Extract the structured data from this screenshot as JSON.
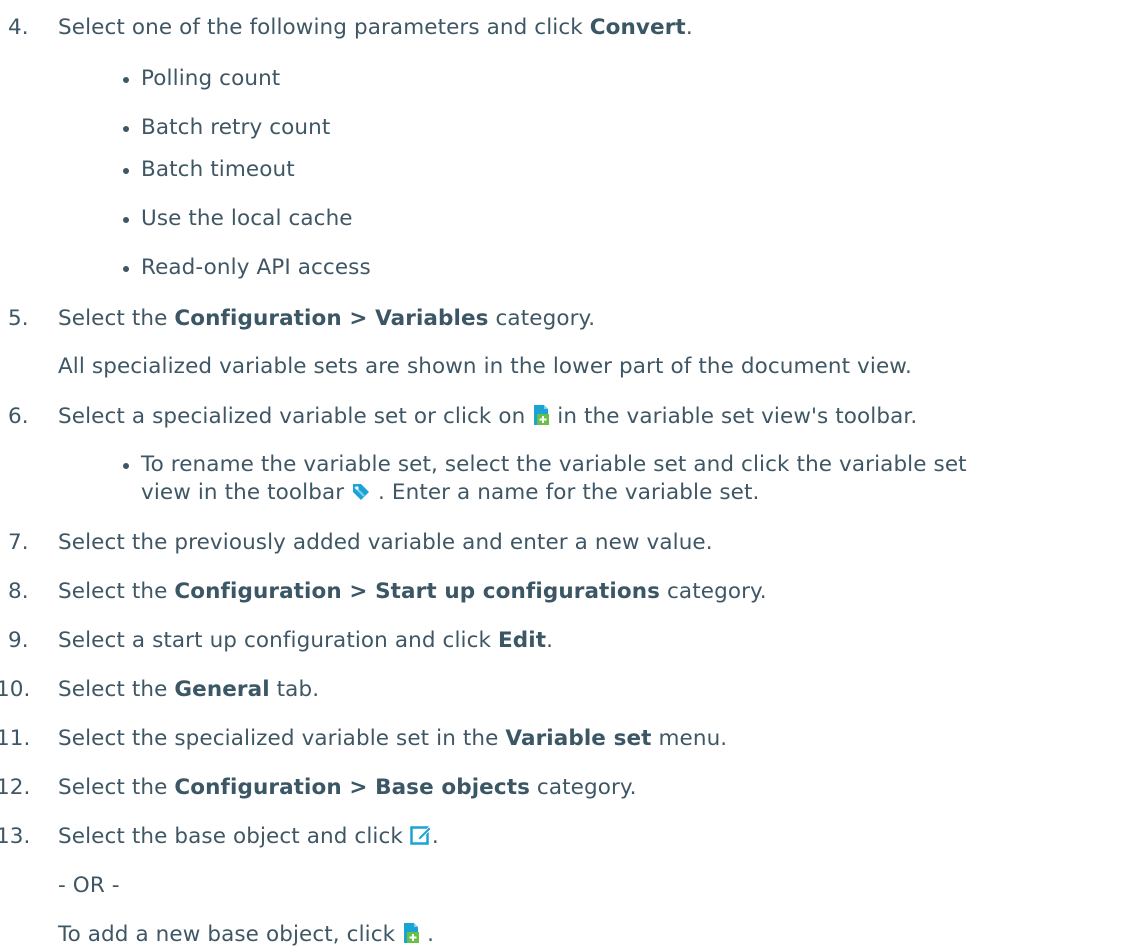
{
  "steps": [
    {
      "number": "4.",
      "pre": "Select one of the following parameters and click ",
      "bold": "Convert",
      "post": "."
    },
    {
      "number": "5.",
      "pre": "Select the ",
      "bold": "Configuration > Variables",
      "post": " category."
    },
    {
      "number": "6.",
      "pre": "Select a specialized variable set or click on ",
      "post": " in the variable set view's toolbar."
    },
    {
      "number": "7.",
      "text": "Select the previously added variable and enter a new value."
    },
    {
      "number": "8.",
      "pre": "Select the ",
      "bold": "Configuration > Start up configurations",
      "post": " category."
    },
    {
      "number": "9.",
      "pre": "Select a start up configuration and click ",
      "bold": "Edit",
      "post": "."
    },
    {
      "number": "10.",
      "pre": "Select the ",
      "bold": "General",
      "post": " tab."
    },
    {
      "number": "11.",
      "pre": "Select the specialized variable set in the ",
      "bold": "Variable set",
      "post": " menu."
    },
    {
      "number": "12.",
      "pre": "Select the ",
      "bold": "Configuration > Base objects",
      "post": " category."
    },
    {
      "number": "13.",
      "pre": "Select the base object and click ",
      "post": "."
    }
  ],
  "step4_bullets": [
    "Polling count",
    "Batch retry count",
    "Batch timeout",
    "Use the local cache",
    "Read-only API access"
  ],
  "step5_note": "All specialized variable sets are shown in the lower part of the document view.",
  "step6_bullet": {
    "line1": "To rename the variable set, select the variable set and click the variable set",
    "line2_pre": "view in the toolbar ",
    "line2_post": ". Enter a name for the variable set."
  },
  "step13_or": "- OR -",
  "step13_alt_pre": "To add a new base object, click ",
  "step13_alt_post": " .",
  "icons": {
    "add": "add-document-icon",
    "tag": "tag-icon",
    "edit": "edit-icon"
  },
  "colors": {
    "text": "#3f5765",
    "icon_blue": "#1aa3d4",
    "icon_green": "#6abf45"
  }
}
